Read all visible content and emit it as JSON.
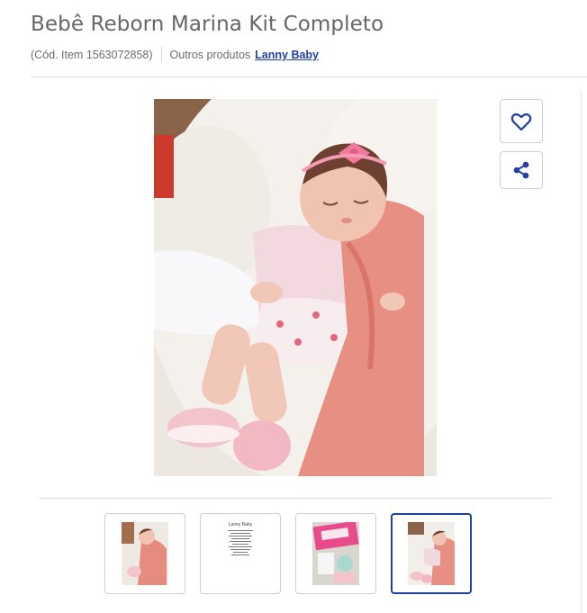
{
  "product": {
    "title": "Bebê Reborn Marina Kit Completo",
    "item_code": "(Cód. Item 1563072858)",
    "seller_prefix": "Outros produtos",
    "seller_name": "Lanny Baby"
  },
  "actions": {
    "favorite_icon": "heart-icon",
    "share_icon": "share-icon"
  },
  "gallery": {
    "main_image": "reborn-baby-doll-sleeping-on-white-fur",
    "thumbnails": [
      {
        "kind": "photo-doll-in-pink-blanket",
        "selected": false
      },
      {
        "kind": "document-checklist",
        "text": "Lanny Baby",
        "selected": false
      },
      {
        "kind": "photo-gift-box-with-items",
        "selected": false
      },
      {
        "kind": "photo-doll-on-fur",
        "selected": true
      }
    ]
  },
  "colors": {
    "accent": "#1f3fa3",
    "title": "#666666",
    "border": "#cfcfcf"
  }
}
